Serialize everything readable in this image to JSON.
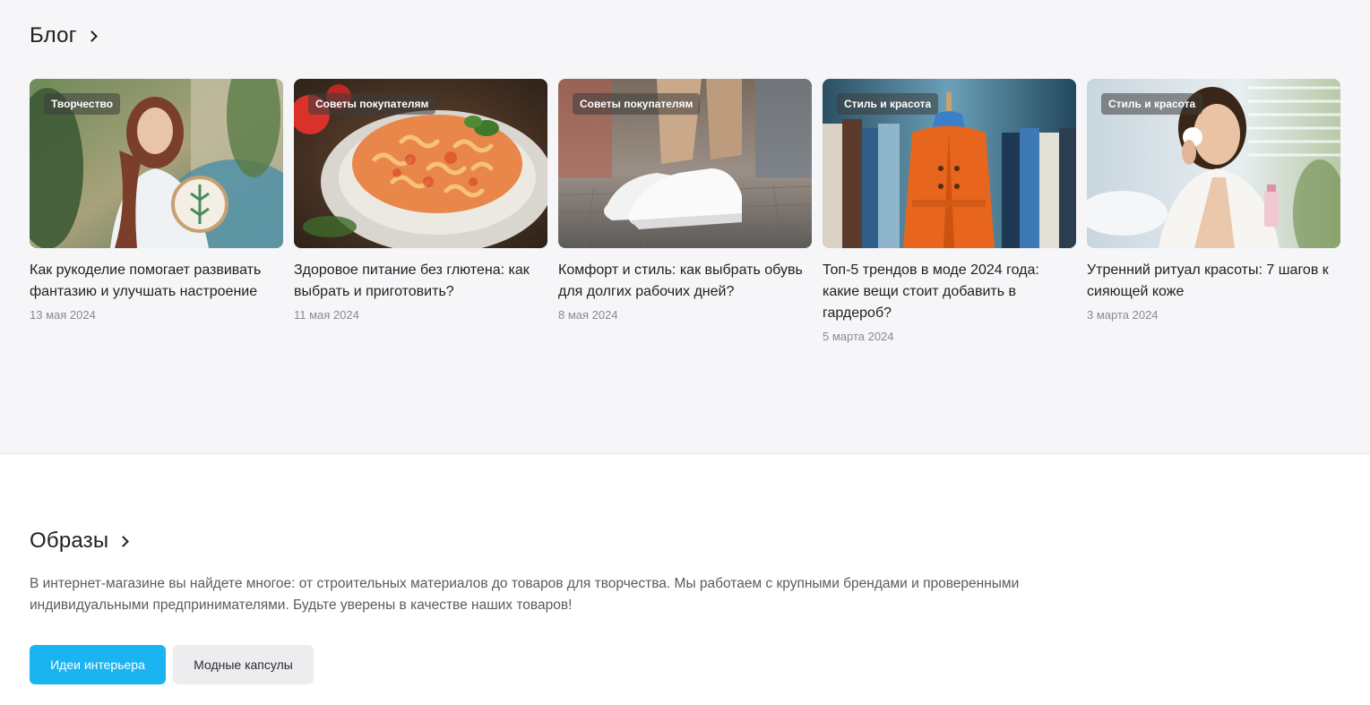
{
  "blog": {
    "title": "Блог",
    "cards": [
      {
        "tag": "Творчество",
        "title": "Как рукоделие помогает развивать фантазию и улучшать настроение",
        "date": "13 мая 2024",
        "image": "woman-embroidery"
      },
      {
        "tag": "Советы покупателям",
        "title": "Здоровое питание без глютена: как выбрать и приготовить?",
        "date": "11 мая 2024",
        "image": "pasta-plate"
      },
      {
        "tag": "Советы покупателям",
        "title": "Комфорт и стиль: как выбрать обувь для долгих рабочих дней?",
        "date": "8 мая 2024",
        "image": "white-sneakers"
      },
      {
        "tag": "Стиль и красота",
        "title": "Топ-5 трендов в моде 2024 года: какие вещи стоит добавить в гардероб?",
        "date": "5 марта 2024",
        "image": "orange-coat-mannequin"
      },
      {
        "tag": "Стиль и красота",
        "title": "Утренний ритуал красоты: 7 шагов к сияющей коже",
        "date": "3 марта 2024",
        "image": "woman-skincare"
      }
    ]
  },
  "looks": {
    "title": "Образы",
    "description": "В интернет-магазине вы найдете многое: от строительных материалов до товаров для творчества. Мы работаем с крупными брендами и проверенными индивидуальными предпринимателями. Будьте уверены в качестве наших товаров!",
    "buttons": [
      {
        "label": "Идеи интерьера",
        "active": true
      },
      {
        "label": "Модные капсулы",
        "active": false
      }
    ]
  },
  "colors": {
    "accent": "#1ab4f1",
    "section_bg": "#f6f6f9",
    "secondary_button": "#ededf0",
    "muted_text": "#8a8a8f"
  }
}
